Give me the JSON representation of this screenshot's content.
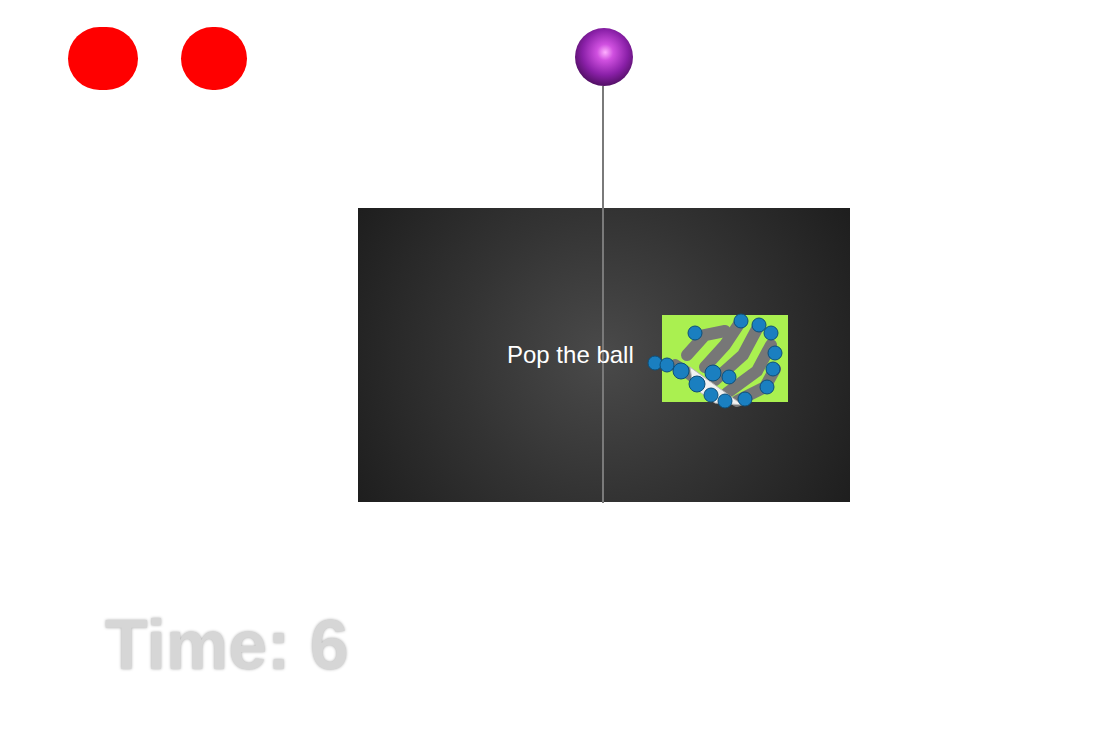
{
  "lives": [
    {
      "lost": false
    },
    {
      "lost": false
    }
  ],
  "prompt": "Pop the ball",
  "timer": "Time: 6"
}
